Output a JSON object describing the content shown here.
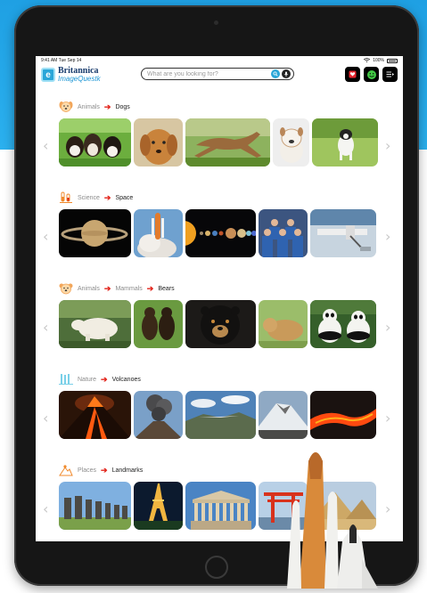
{
  "status_bar": {
    "time_date": "9:41 AM   Tue Sep 14",
    "battery": "100%"
  },
  "logo": {
    "brand": "Britannica",
    "product": "ImageQuest",
    "badge": "e",
    "product_suffix": "k"
  },
  "search": {
    "placeholder": "What are you looking for?"
  },
  "header_actions": [
    {
      "name": "favorites-icon",
      "color": "#e8262f"
    },
    {
      "name": "smiley-icon",
      "color": "#41c744"
    },
    {
      "name": "menu-list-icon",
      "color": "#ffffff"
    }
  ],
  "categories": [
    {
      "icon": "dog-face-icon",
      "crumbs": [
        "Animals"
      ],
      "current": "Dogs",
      "thumbs": [
        "puppies-on-grass",
        "golden-retriever",
        "running-greyhound",
        "bulldog",
        "jumping-terrier"
      ]
    },
    {
      "icon": "test-tubes-icon",
      "crumbs": [
        "Science"
      ],
      "current": "Space",
      "thumbs": [
        "saturn",
        "shuttle-launch",
        "solar-system",
        "astronaut-crew",
        "space-station"
      ]
    },
    {
      "icon": "bear-face-icon",
      "crumbs": [
        "Animals",
        "Mammals"
      ],
      "current": "Bears",
      "thumbs": [
        "polar-bear",
        "bear-cubs",
        "sun-bear",
        "brown-bear",
        "pandas"
      ]
    },
    {
      "icon": "waterfall-icon",
      "crumbs": [
        "Nature"
      ],
      "current": "Volcanoes",
      "thumbs": [
        "erupting-volcano",
        "ash-plume",
        "crater-lake",
        "snow-volcano",
        "lava-flow"
      ]
    },
    {
      "icon": "mountain-sun-icon",
      "crumbs": [
        "Places"
      ],
      "current": "Landmarks",
      "thumbs": [
        "moai-statues",
        "eiffel-tower",
        "parthenon",
        "torii-gate",
        "pyramids"
      ]
    }
  ],
  "colors": {
    "background_band": "#1fa0e3",
    "arrow": "#e2231a",
    "brand_blue": "#2aa6d8"
  }
}
